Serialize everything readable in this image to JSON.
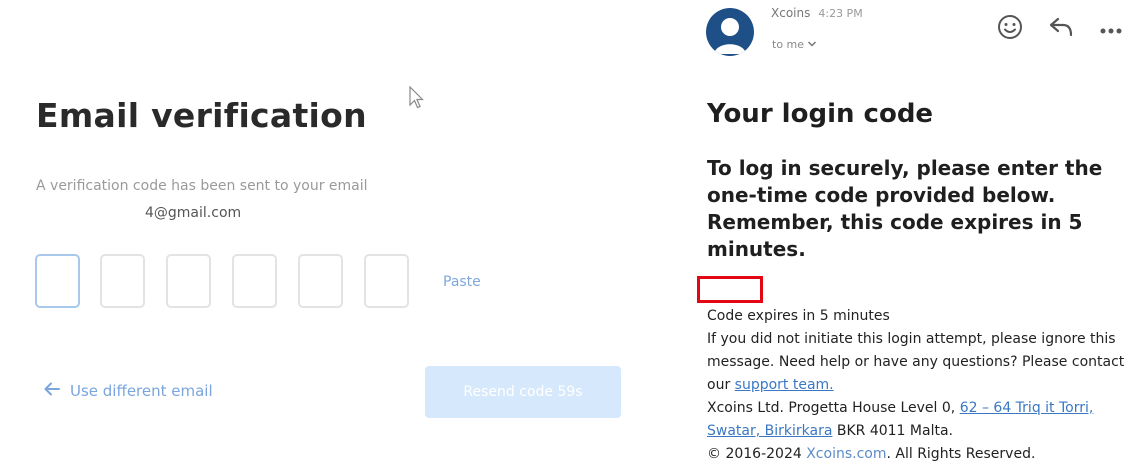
{
  "verification": {
    "title": "Email verification",
    "subtitle": "A verification code has been sent to your email",
    "email": "4@gmail.com",
    "paste_label": "Paste",
    "back_label": "Use different email",
    "resend_label": "Resend code 59s"
  },
  "email": {
    "sender": "Xcoins",
    "time": "4:23 PM",
    "recipient": "to me",
    "title": "Your login code",
    "intro": "To log in securely, please enter the one-time code provided below. Remember, this code expires in 5 minutes.",
    "code": "",
    "expiry": "Code expires in 5 minutes",
    "body_text": "If you did not initiate this login attempt, please ignore this message. Need help or have any questions? Please contact our ",
    "support_link": "support team.",
    "address_prefix": "Xcoins Ltd. Progetta House Level 0, ",
    "address_link": "62 – 64 Triq it Torri, Swatar, Birkirkara",
    "address_suffix": " BKR 4011 Malta.",
    "copyright_prefix": "© 2016-2024 ",
    "copyright_link": "Xcoins.com",
    "copyright_suffix": ". All Rights Reserved."
  },
  "colors": {
    "accent": "#7aa5dd",
    "button_bg": "#d6e8fb",
    "redaction": "#e30613",
    "avatar": "#1f4f87",
    "link": "#3a78c3"
  },
  "icons": [
    "mouse-cursor-icon",
    "arrow-left-icon",
    "avatar-icon",
    "chevron-down-icon",
    "emoji-icon",
    "reply-icon",
    "more-icon"
  ]
}
